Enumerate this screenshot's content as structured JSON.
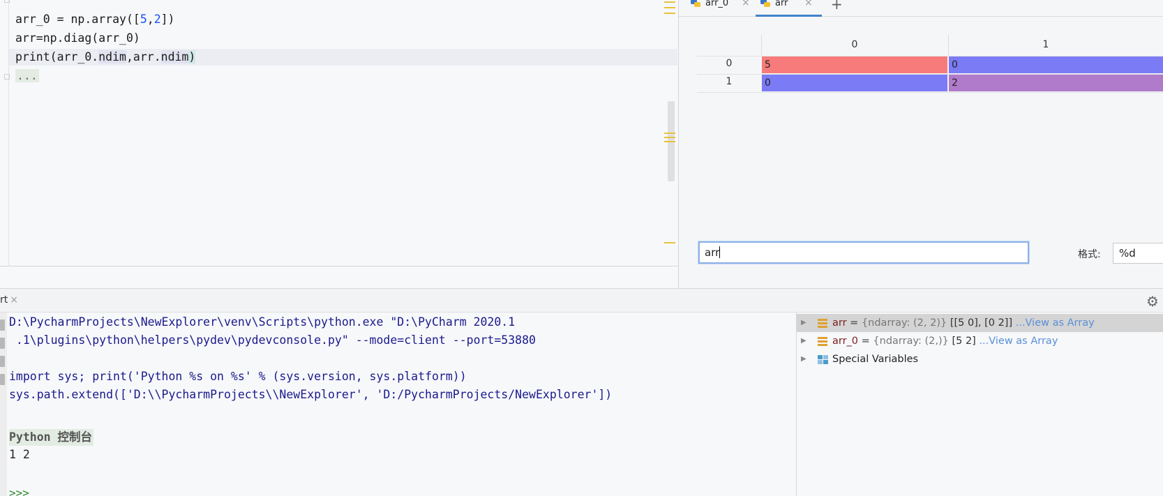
{
  "editor": {
    "lines": [
      {
        "pre": "arr_0 = np.array([",
        "n1": "5",
        "mid": ",",
        "n2": "2",
        "post": "])"
      },
      {
        "text": "arr=np.diag(arr_0)"
      },
      {
        "p1": "print(",
        "a1": "arr_0.",
        "a2": "ndim",
        "a3": ",arr.",
        "a4": "ndim",
        "p2": ")"
      },
      {
        "text": "..."
      }
    ]
  },
  "sciview": {
    "tabs": [
      {
        "label": "arr_0"
      },
      {
        "label": "arr"
      }
    ],
    "add_tab": "+",
    "close_glyph": "×",
    "column_headers": [
      "0",
      "1"
    ],
    "row_headers": [
      "0",
      "1"
    ],
    "cells": [
      [
        "5",
        "0"
      ],
      [
        "0",
        "2"
      ]
    ],
    "cell_colors": [
      [
        "#f77b7b",
        "#7b7bf6"
      ],
      [
        "#7b7bf6",
        "#b07bca"
      ]
    ],
    "variable_input": "arr",
    "format_label": "格式:",
    "format_value": "%d"
  },
  "console": {
    "tab_label": "rt",
    "lines": [
      "D:\\PycharmProjects\\NewExplorer\\venv\\Scripts\\python.exe \"D:\\PyCharm 2020.1",
      " .1\\plugins\\python\\helpers\\pydev\\pydevconsole.py\" --mode=client --port=53880",
      "import sys; print('Python %s on %s' % (sys.version, sys.platform))",
      "sys.path.extend(['D:\\\\PycharmProjects\\\\NewExplorer', 'D:/PycharmProjects/NewExplorer'])"
    ],
    "title": "Python 控制台",
    "output": "1 2",
    "prompt": ">>>"
  },
  "variables": [
    {
      "name": "arr",
      "eq": " = ",
      "type": "{ndarray: (2, 2)}",
      "value": " [[5 0], [0 2]] ",
      "link": "...View as Array"
    },
    {
      "name": "arr_0",
      "eq": " = ",
      "type": "{ndarray: (2,)}",
      "value": " [5 2] ",
      "link": "...View as Array"
    },
    {
      "name": "Special Variables"
    }
  ],
  "colors": {
    "accent": "#4083c9",
    "cell_red": "#f77b7b",
    "cell_blue": "#7b7bf6",
    "cell_purple": "#b07bca"
  }
}
